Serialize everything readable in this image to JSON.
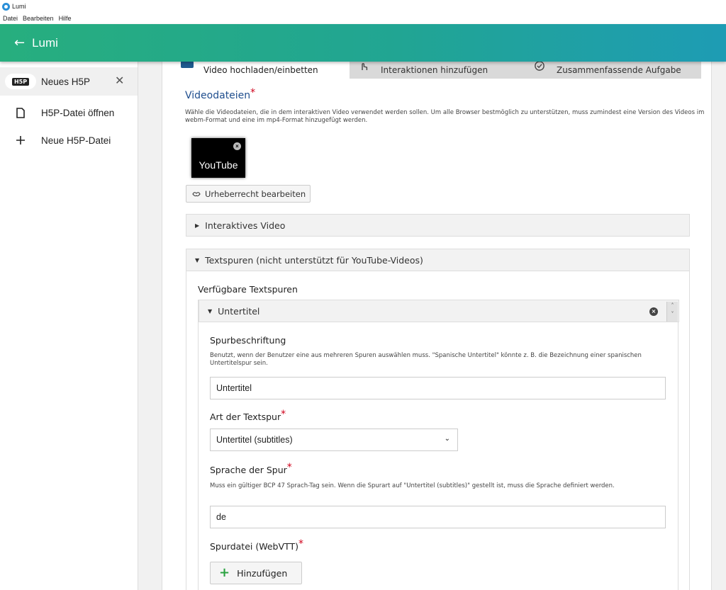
{
  "window": {
    "title": "Lumi"
  },
  "menubar": {
    "items": [
      "Datei",
      "Bearbeiten",
      "Hilfe"
    ]
  },
  "appbar": {
    "back_icon": "arrow-left-icon",
    "title": "Lumi"
  },
  "sidebar": {
    "items": [
      {
        "label": "Neues H5P",
        "icon": "h5p-logo",
        "active": true
      },
      {
        "label": "H5P-Datei öffnen",
        "icon": "file-icon"
      },
      {
        "label": "Neue H5P-Datei",
        "icon": "plus-icon"
      }
    ],
    "logo_text": "H5P",
    "close_glyph": "✕"
  },
  "tabs": [
    {
      "label": "Video hochladen/einbetten",
      "icon": "video-icon",
      "active": true
    },
    {
      "label": "Interaktionen hinzufügen",
      "icon": "touch-icon"
    },
    {
      "label": "Zusammenfassende Aufgabe",
      "icon": "check-circle-icon"
    }
  ],
  "videofiles": {
    "title": "Videodateien",
    "required": "*",
    "description": "Wähle die Videodateien, die in dem interaktiven Video verwendet werden sollen. Um alle Browser bestmöglich zu unterstützen, muss zumindest eine Version des Videos im webm-Format und eine im mp4-Format hinzugefügt werden.",
    "thumb_label": "YouTube",
    "copyright_button": "Urheberrecht bearbeiten"
  },
  "groups": {
    "interactive_video": "Interaktives Video",
    "text_tracks": "Textspuren (nicht unterstützt für YouTube-Videos)"
  },
  "tracks": {
    "available_label": "Verfügbare Textspuren",
    "item_title": "Untertitel",
    "label_field": {
      "label": "Spurbeschriftung",
      "description": "Benutzt, wenn der Benutzer eine aus mehreren Spuren auswählen muss. \"Spanische Untertitel\" könnte z. B. die Bezeichnung einer spanischen Untertitelspur sein.",
      "value": "Untertitel"
    },
    "kind_field": {
      "label": "Art der Textspur",
      "required": "*",
      "value": "Untertitel (subtitles)"
    },
    "lang_field": {
      "label": "Sprache der Spur",
      "required": "*",
      "description": "Muss ein gültiger BCP 47 Sprach-Tag sein. Wenn die Spurart auf \"Untertitel (subtitles)\" gestellt ist, muss die Sprache definiert werden.",
      "value": "de"
    },
    "file_field": {
      "label": "Spurdatei (WebVTT)",
      "required": "*",
      "add_button": "Hinzufügen"
    }
  }
}
